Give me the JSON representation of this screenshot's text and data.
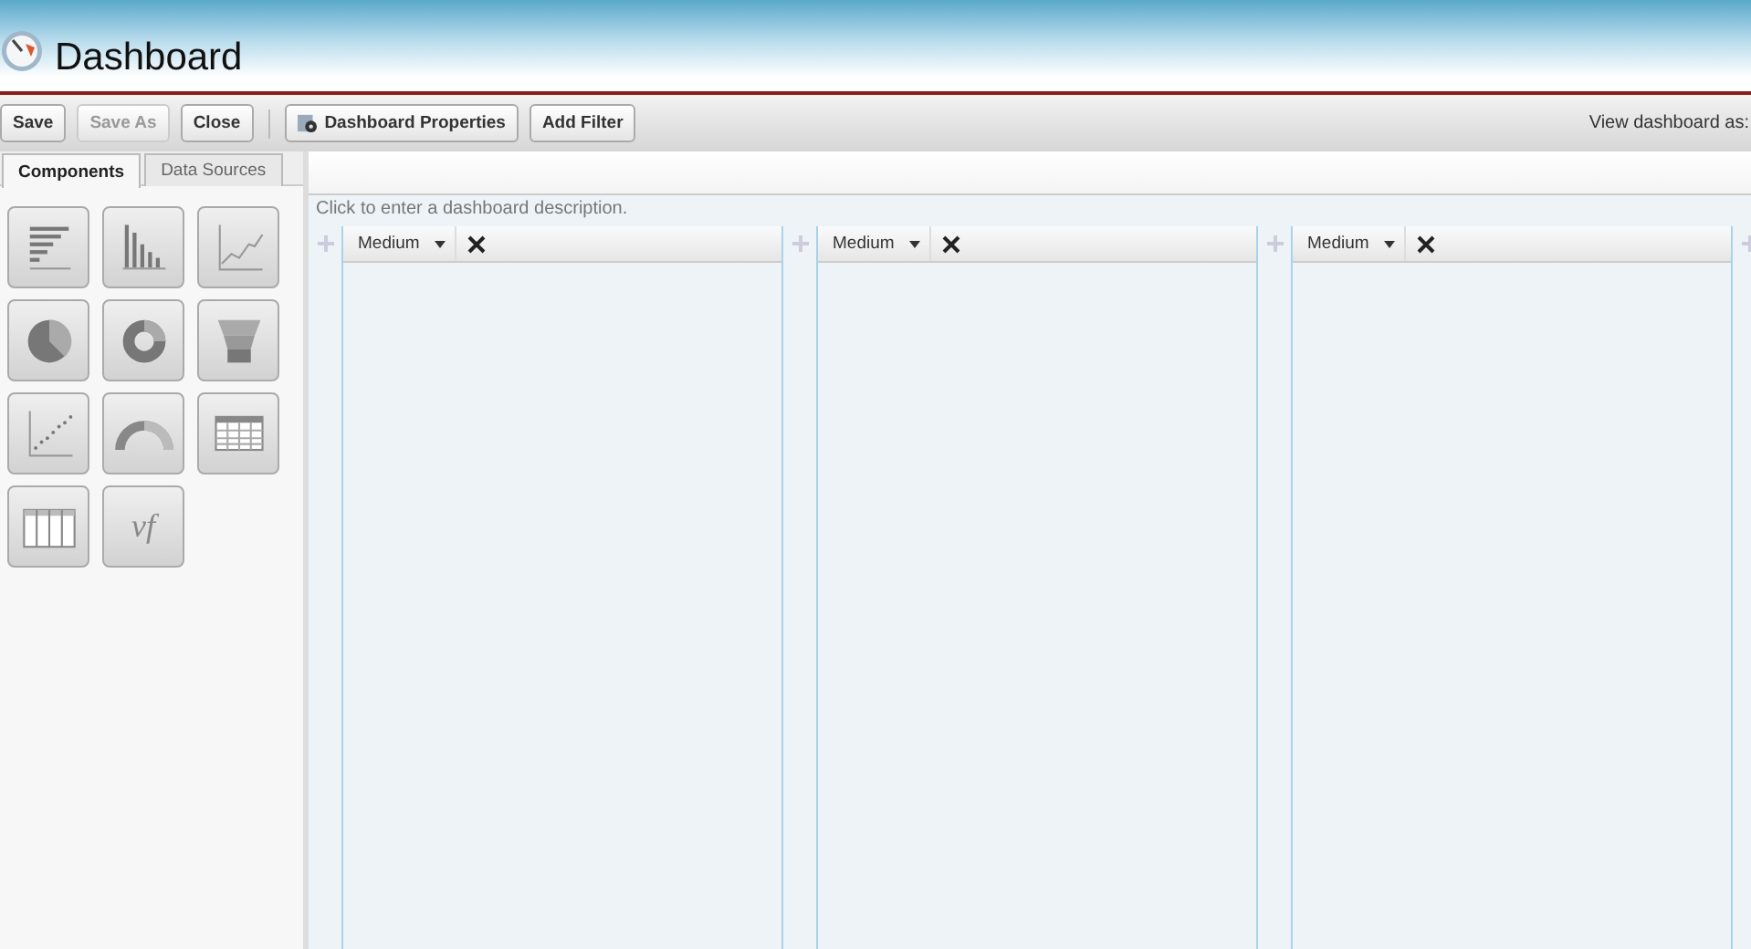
{
  "header": {
    "title": "Dashboard"
  },
  "toolbar": {
    "buttons": [
      {
        "label": "Save",
        "disabled": false,
        "kind": "plain"
      },
      {
        "label": "Save As",
        "disabled": true,
        "kind": "plain"
      },
      {
        "label": "Close",
        "disabled": false,
        "kind": "plain"
      },
      {
        "label": "Dashboard Properties",
        "disabled": false,
        "kind": "properties"
      },
      {
        "label": "Add Filter",
        "disabled": false,
        "kind": "plain"
      }
    ],
    "view_as": "View dashboard as:"
  },
  "sidebar": {
    "tabs": [
      {
        "label": "Components",
        "selected": true
      },
      {
        "label": "Data Sources",
        "selected": false
      }
    ],
    "components": [
      {
        "kind": "hbar"
      },
      {
        "kind": "column"
      },
      {
        "kind": "line"
      },
      {
        "kind": "pie"
      },
      {
        "kind": "donut"
      },
      {
        "kind": "funnel"
      },
      {
        "kind": "scatter"
      },
      {
        "kind": "gauge"
      },
      {
        "kind": "table"
      },
      {
        "kind": "grid"
      },
      {
        "kind": "text",
        "label": "vf"
      }
    ]
  },
  "description_placeholder": "Click to enter a dashboard description.",
  "columns": [
    {
      "size": "Medium"
    },
    {
      "size": "Medium"
    },
    {
      "size": "Medium"
    }
  ]
}
